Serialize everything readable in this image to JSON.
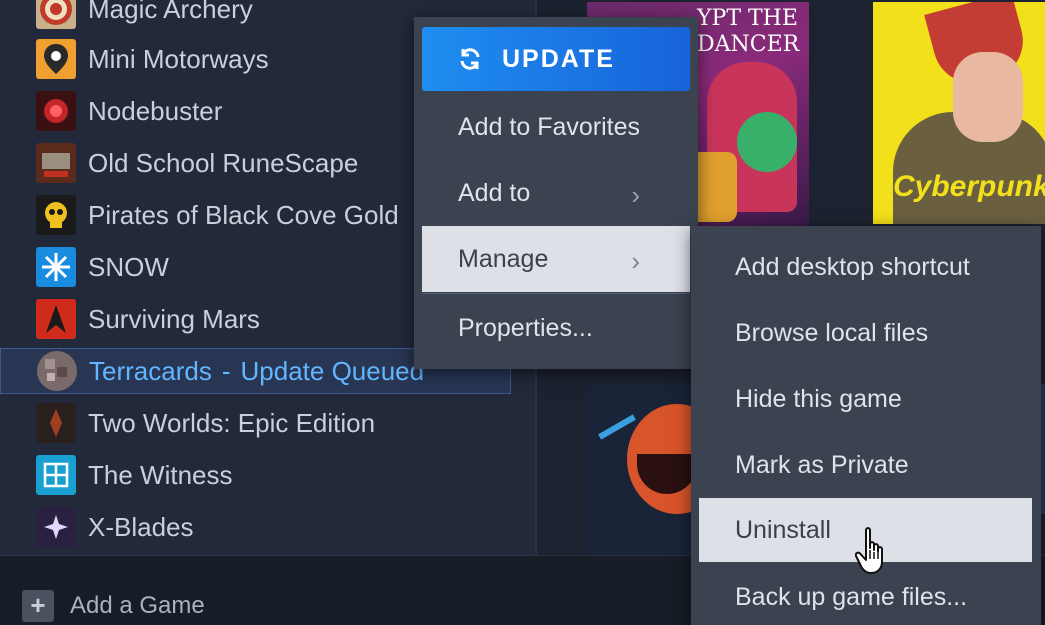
{
  "library": {
    "games": [
      {
        "name": "Magic Archery",
        "icon": "archery-target-icon"
      },
      {
        "name": "Mini Motorways",
        "icon": "map-pin-icon"
      },
      {
        "name": "Nodebuster",
        "icon": "node-icon"
      },
      {
        "name": "Old School RuneScape",
        "icon": "runescape-icon"
      },
      {
        "name": "Pirates of Black Cove Gold",
        "icon": "skull-icon"
      },
      {
        "name": "SNOW",
        "icon": "snowflake-icon"
      },
      {
        "name": "Surviving Mars",
        "icon": "mars-icon"
      },
      {
        "name": "Terracards",
        "status": "Update Queued",
        "separator": "-",
        "icon": "terracards-icon"
      },
      {
        "name": "Two Worlds: Epic Edition",
        "icon": "two-worlds-icon"
      },
      {
        "name": "The Witness",
        "icon": "witness-icon"
      },
      {
        "name": "X-Blades",
        "icon": "xblades-icon"
      }
    ],
    "selected_index": 7
  },
  "bottom_bar": {
    "add_game_label": "Add a Game",
    "add_icon": "plus-icon"
  },
  "shelf": {
    "art1_title": "YPT THE DANCER",
    "art2_logo": "Cyberpunk"
  },
  "context_menu": {
    "update_label": "UPDATE",
    "update_icon": "refresh-icon",
    "items": [
      {
        "label": "Add to Favorites",
        "has_submenu": false
      },
      {
        "label": "Add to",
        "has_submenu": true
      },
      {
        "label": "Manage",
        "has_submenu": true,
        "active": true
      },
      {
        "label": "Properties...",
        "has_submenu": false
      }
    ]
  },
  "manage_submenu": {
    "items": [
      {
        "label": "Add desktop shortcut"
      },
      {
        "label": "Browse local files"
      },
      {
        "label": "Hide this game"
      },
      {
        "label": "Mark as Private"
      },
      {
        "label": "Uninstall",
        "hovered": true
      },
      {
        "label": "Back up game files..."
      }
    ]
  },
  "colors": {
    "accent_blue": "#1a8cf0",
    "selected_text": "#61b6ff",
    "menu_bg": "#3b4250",
    "menu_highlight": "#dde0e6"
  }
}
